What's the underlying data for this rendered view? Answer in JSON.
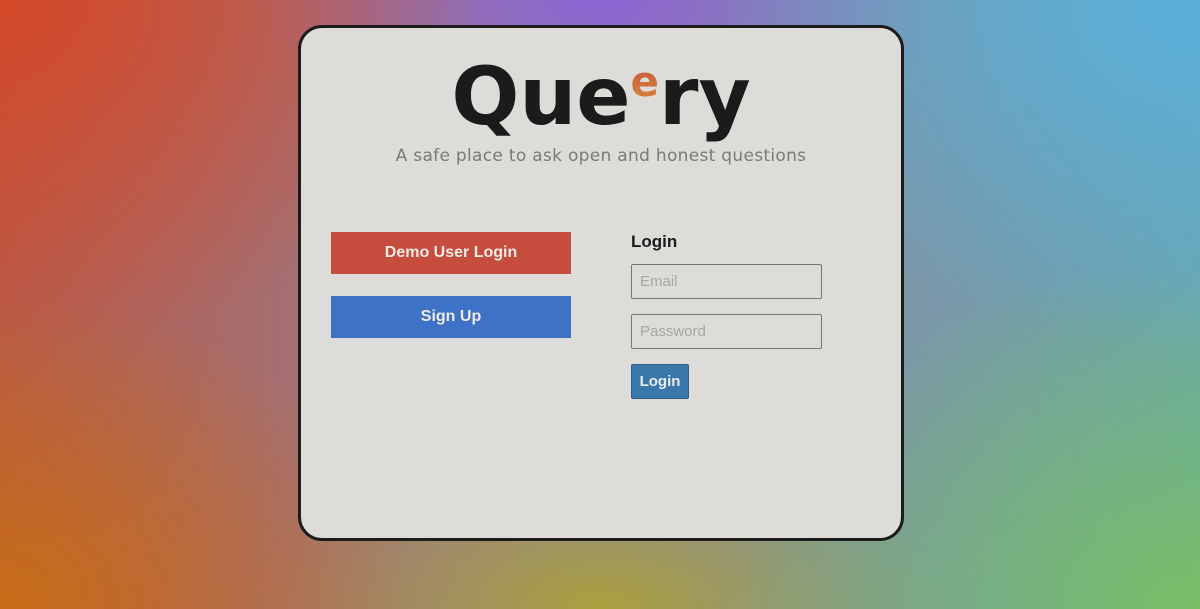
{
  "brand": {
    "name_start": "Que",
    "name_sup": "e",
    "name_end": "ry",
    "tagline": "A safe place to ask open and honest questions"
  },
  "actions": {
    "demo_label": "Demo User Login",
    "signup_label": "Sign Up"
  },
  "login": {
    "heading": "Login",
    "email_placeholder": "Email",
    "password_placeholder": "Password",
    "submit_label": "Login"
  },
  "colors": {
    "demo_button": "#c64d3e",
    "signup_button": "#3d72c7",
    "login_button": "#3a77ab",
    "card_background": "#dddcd9"
  }
}
